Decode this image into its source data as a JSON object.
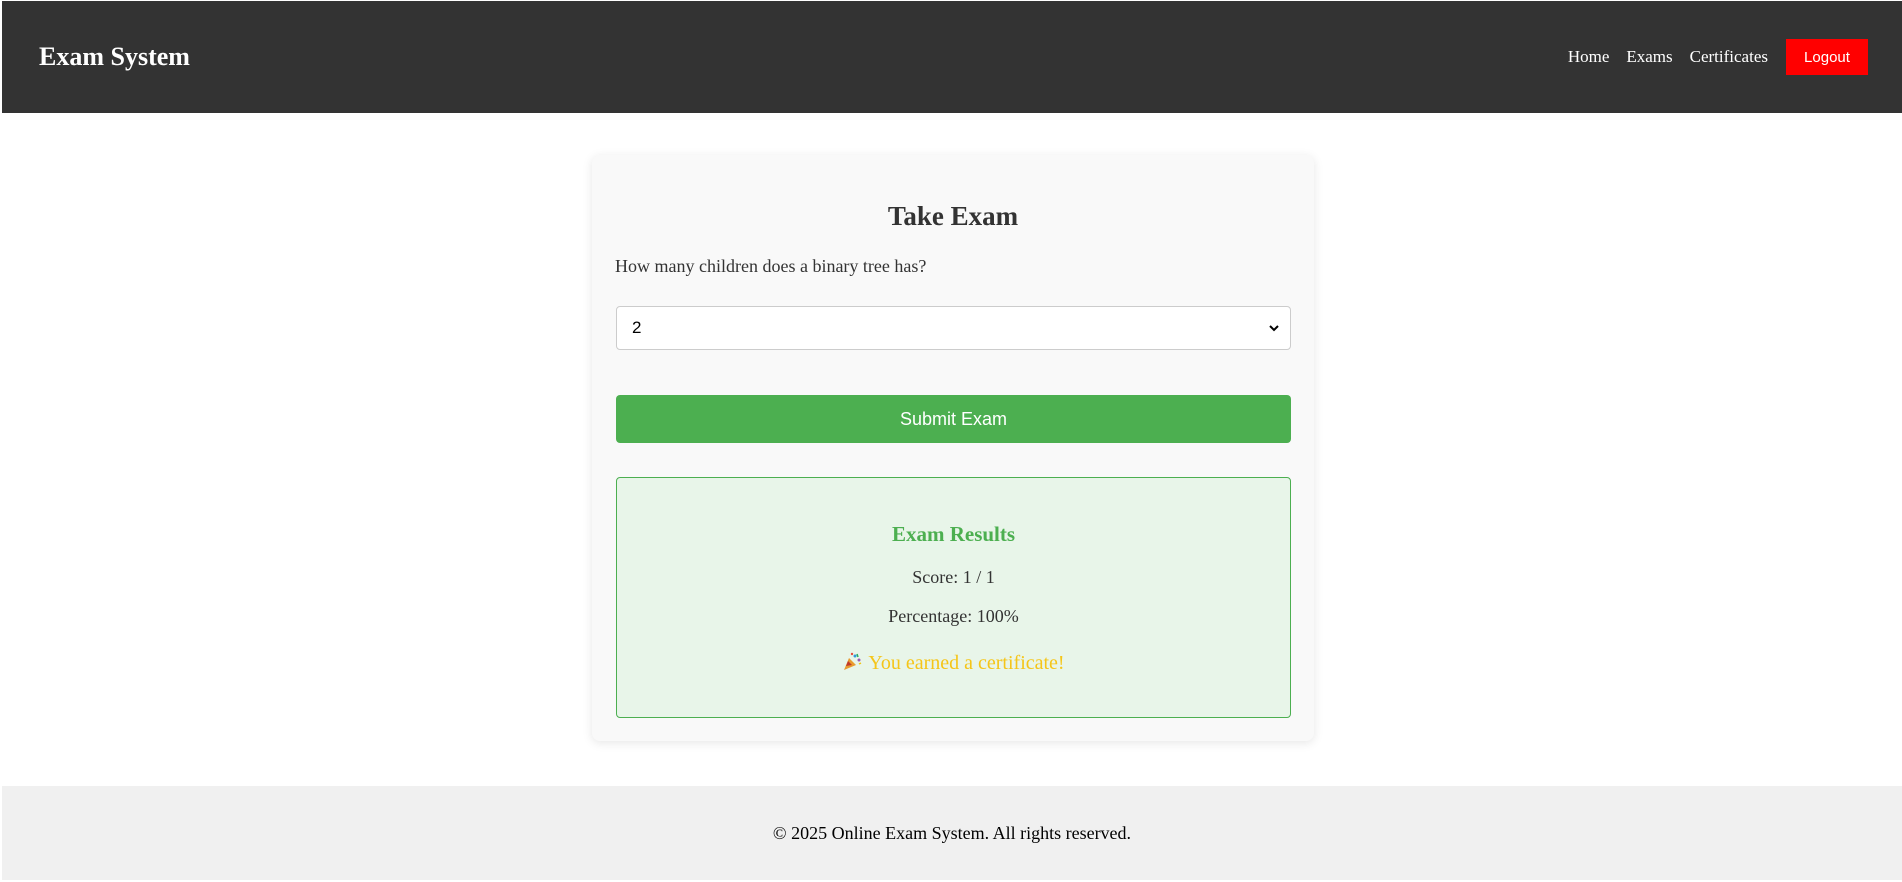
{
  "header": {
    "brand": "Exam System",
    "nav": {
      "home": "Home",
      "exams": "Exams",
      "certificates": "Certificates"
    },
    "logout_label": "Logout"
  },
  "exam": {
    "title": "Take Exam",
    "question": "How many children does a binary tree has?",
    "selected_answer": "2",
    "submit_label": "Submit Exam"
  },
  "results": {
    "title": "Exam Results",
    "score": "Score: 1 / 1",
    "percentage": "Percentage: 100%",
    "certificate_message": "You earned a certificate!",
    "certificate_icon": "party-popper-icon"
  },
  "footer": {
    "text": "© 2025 Online Exam System. All rights reserved."
  },
  "colors": {
    "header_bg": "#333333",
    "logout_bg": "#ff0000",
    "submit_bg": "#4caf50",
    "results_bg": "#e8f5e9",
    "results_accent": "#4caf50",
    "certificate_text": "#f5c518",
    "footer_bg": "#f0f0f0"
  }
}
